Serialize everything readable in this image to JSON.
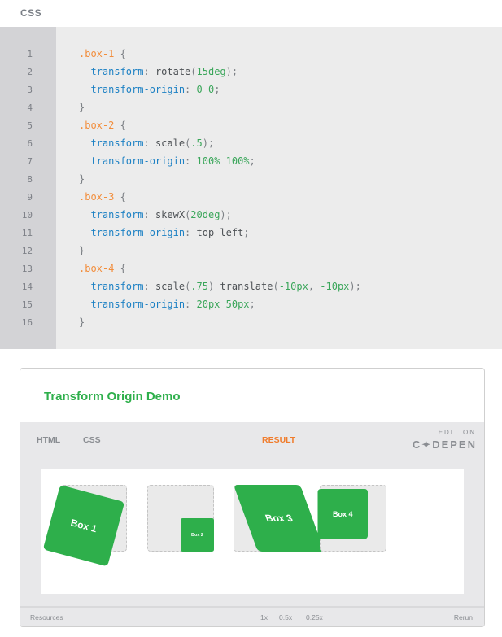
{
  "editor": {
    "language_label": "CSS",
    "line_numbers": [
      "1",
      "2",
      "3",
      "4",
      "5",
      "6",
      "7",
      "8",
      "9",
      "10",
      "11",
      "12",
      "13",
      "14",
      "15",
      "16"
    ],
    "lines": [
      [
        {
          "t": "sel",
          "s": ".box-1"
        },
        {
          "t": "punc",
          "s": " {"
        }
      ],
      [
        {
          "t": "sp",
          "s": "  "
        },
        {
          "t": "prop",
          "s": "transform"
        },
        {
          "t": "punc",
          "s": ": "
        },
        {
          "t": "val",
          "s": "rotate"
        },
        {
          "t": "punc",
          "s": "("
        },
        {
          "t": "num",
          "s": "15deg"
        },
        {
          "t": "punc",
          "s": ");"
        }
      ],
      [
        {
          "t": "sp",
          "s": "  "
        },
        {
          "t": "prop",
          "s": "transform-origin"
        },
        {
          "t": "punc",
          "s": ": "
        },
        {
          "t": "num",
          "s": "0 0"
        },
        {
          "t": "punc",
          "s": ";"
        }
      ],
      [
        {
          "t": "punc",
          "s": "}"
        }
      ],
      [
        {
          "t": "sel",
          "s": ".box-2"
        },
        {
          "t": "punc",
          "s": " {"
        }
      ],
      [
        {
          "t": "sp",
          "s": "  "
        },
        {
          "t": "prop",
          "s": "transform"
        },
        {
          "t": "punc",
          "s": ": "
        },
        {
          "t": "val",
          "s": "scale"
        },
        {
          "t": "punc",
          "s": "("
        },
        {
          "t": "num",
          "s": ".5"
        },
        {
          "t": "punc",
          "s": ");"
        }
      ],
      [
        {
          "t": "sp",
          "s": "  "
        },
        {
          "t": "prop",
          "s": "transform-origin"
        },
        {
          "t": "punc",
          "s": ": "
        },
        {
          "t": "num",
          "s": "100% 100%"
        },
        {
          "t": "punc",
          "s": ";"
        }
      ],
      [
        {
          "t": "punc",
          "s": "}"
        }
      ],
      [
        {
          "t": "sel",
          "s": ".box-3"
        },
        {
          "t": "punc",
          "s": " {"
        }
      ],
      [
        {
          "t": "sp",
          "s": "  "
        },
        {
          "t": "prop",
          "s": "transform"
        },
        {
          "t": "punc",
          "s": ": "
        },
        {
          "t": "val",
          "s": "skewX"
        },
        {
          "t": "punc",
          "s": "("
        },
        {
          "t": "num",
          "s": "20deg"
        },
        {
          "t": "punc",
          "s": ");"
        }
      ],
      [
        {
          "t": "sp",
          "s": "  "
        },
        {
          "t": "prop",
          "s": "transform-origin"
        },
        {
          "t": "punc",
          "s": ": "
        },
        {
          "t": "val",
          "s": "top left"
        },
        {
          "t": "punc",
          "s": ";"
        }
      ],
      [
        {
          "t": "punc",
          "s": "}"
        }
      ],
      [
        {
          "t": "sel",
          "s": ".box-4"
        },
        {
          "t": "punc",
          "s": " {"
        }
      ],
      [
        {
          "t": "sp",
          "s": "  "
        },
        {
          "t": "prop",
          "s": "transform"
        },
        {
          "t": "punc",
          "s": ": "
        },
        {
          "t": "val",
          "s": "scale"
        },
        {
          "t": "punc",
          "s": "("
        },
        {
          "t": "num",
          "s": ".75"
        },
        {
          "t": "punc",
          "s": ") "
        },
        {
          "t": "val",
          "s": "translate"
        },
        {
          "t": "punc",
          "s": "("
        },
        {
          "t": "num",
          "s": "-10px"
        },
        {
          "t": "punc",
          "s": ", "
        },
        {
          "t": "num",
          "s": "-10px"
        },
        {
          "t": "punc",
          "s": ");"
        }
      ],
      [
        {
          "t": "sp",
          "s": "  "
        },
        {
          "t": "prop",
          "s": "transform-origin"
        },
        {
          "t": "punc",
          "s": ": "
        },
        {
          "t": "num",
          "s": "20px 50px"
        },
        {
          "t": "punc",
          "s": ";"
        }
      ],
      [
        {
          "t": "punc",
          "s": "}"
        }
      ]
    ]
  },
  "pen": {
    "title": "Transform Origin Demo",
    "tabs": {
      "html": "HTML",
      "css": "CSS",
      "result": "RESULT"
    },
    "edit_on": "EDIT ON",
    "codepen": "C✦DEPEN",
    "boxes": [
      "Box 1",
      "Box 2",
      "Box 3",
      "Box 4"
    ],
    "footer": {
      "resources": "Resources",
      "zoom_options": [
        "1x",
        "0.5x",
        "0.25x"
      ],
      "rerun": "Rerun"
    }
  },
  "colors": {
    "accent_green": "#2eaf4b",
    "active_tab_orange": "#f07c2c",
    "selector_orange": "#f28d3b",
    "property_blue": "#1d81c4"
  }
}
